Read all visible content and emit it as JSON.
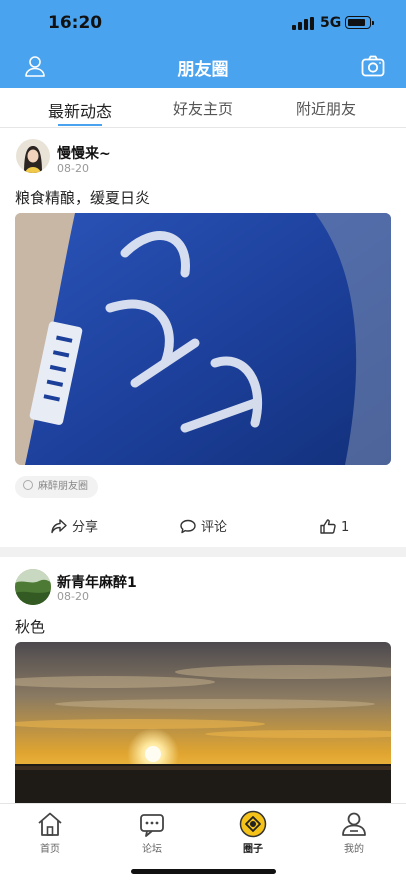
{
  "status_bar": {
    "time": "16:20",
    "network": "5G"
  },
  "nav": {
    "title": "朋友圈",
    "left_icon": "user-icon",
    "right_icon": "camera-icon"
  },
  "tabs": [
    {
      "label": "最新动态",
      "active": true
    },
    {
      "label": "好友主页",
      "active": false
    },
    {
      "label": "附近朋友",
      "active": false
    }
  ],
  "posts": [
    {
      "author": "慢慢来~",
      "date": "08-20",
      "text": "粮食精酿，缓夏日炎",
      "tag": "麻醉朋友圈",
      "actions": {
        "share": "分享",
        "comment": "评论",
        "like_count": "1"
      }
    },
    {
      "author": "新青年麻醉1",
      "date": "08-20",
      "text": "秋色"
    }
  ],
  "tabbar": [
    {
      "label": "首页",
      "icon": "home-icon",
      "active": false
    },
    {
      "label": "论坛",
      "icon": "forum-icon",
      "active": false
    },
    {
      "label": "圈子",
      "icon": "circle-icon",
      "active": true
    },
    {
      "label": "我的",
      "icon": "profile-icon",
      "active": false
    }
  ],
  "colors": {
    "primary": "#4aa3ee",
    "divider": "#f1f1f1",
    "circle_accent": "#f5c21a"
  }
}
